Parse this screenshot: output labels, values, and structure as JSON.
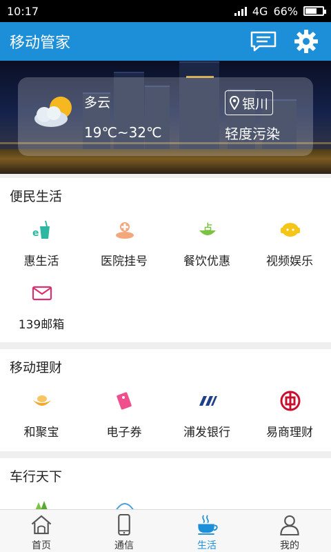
{
  "status_bar": {
    "time": "10:17",
    "network": "4G",
    "battery_percent": "66%",
    "battery_level": 0.66
  },
  "app_bar": {
    "title": "移动管家",
    "icons": [
      "message-icon",
      "gear-icon"
    ]
  },
  "weather": {
    "condition": "多云",
    "temperature": "19℃~32℃",
    "city": "银川",
    "air_quality": "轻度污染"
  },
  "sections": [
    {
      "title": "便民生活",
      "items": [
        {
          "label": "惠生活",
          "icon": "drink-cup-icon"
        },
        {
          "label": "医院挂号",
          "icon": "hospital-icon"
        },
        {
          "label": "餐饮优惠",
          "icon": "dining-icon"
        },
        {
          "label": "视频娱乐",
          "icon": "video-icon"
        },
        {
          "label": "139邮箱",
          "icon": "mail-icon"
        }
      ]
    },
    {
      "title": "移动理财",
      "items": [
        {
          "label": "和聚宝",
          "icon": "gold-ingot-icon"
        },
        {
          "label": "电子券",
          "icon": "coupon-icon"
        },
        {
          "label": "浦发银行",
          "icon": "spd-bank-icon"
        },
        {
          "label": "易商理财",
          "icon": "boc-icon"
        }
      ]
    },
    {
      "title": "车行天下",
      "items": [
        {
          "label": "",
          "icon": "map-location-icon"
        },
        {
          "label": "",
          "icon": "umbrella-icon"
        }
      ]
    }
  ],
  "bottom_nav": [
    {
      "label": "首页",
      "icon": "home-icon",
      "active": false
    },
    {
      "label": "通信",
      "icon": "phone-icon",
      "active": false
    },
    {
      "label": "生活",
      "icon": "coffee-icon",
      "active": true
    },
    {
      "label": "我的",
      "icon": "user-icon",
      "active": false
    }
  ],
  "colors": {
    "primary": "#1d8fd8",
    "status_bar": "#000000",
    "page_bg": "#efefef"
  }
}
